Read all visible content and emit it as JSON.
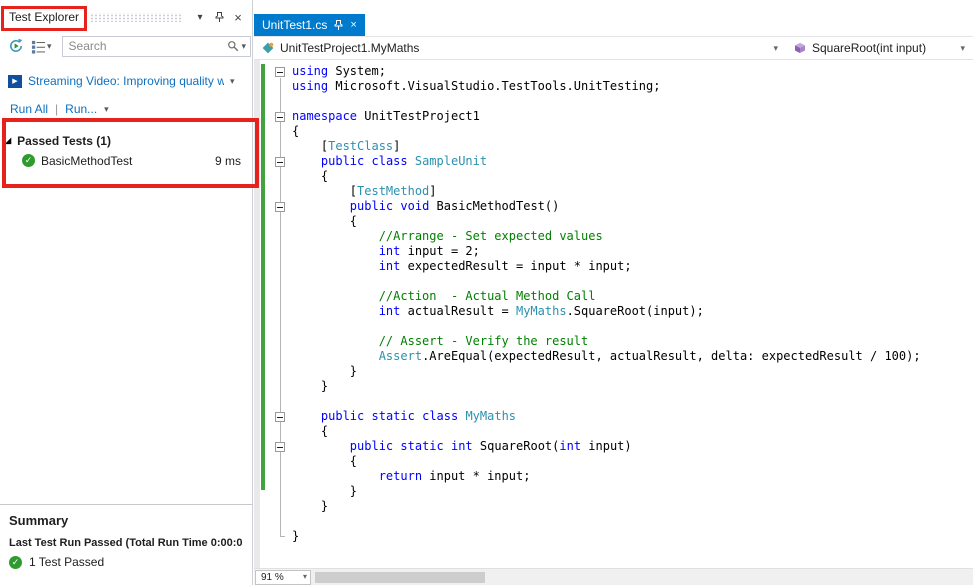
{
  "colors": {
    "accent_blue": "#007acc",
    "link_blue": "#0e70c0",
    "pass_green": "#2f9b2f",
    "change_bar_green": "#40a340",
    "annotation_red": "#e6221d",
    "keyword_blue": "#0000ff",
    "type_teal": "#2b91af",
    "comment_green": "#008000"
  },
  "icons": {
    "chevron_down": "▾",
    "close": "×",
    "check": "✓",
    "expander_expanded": "◢",
    "play": "▶"
  },
  "test_explorer": {
    "title": "Test Explorer",
    "search": {
      "placeholder": "Search"
    },
    "video_link": "Streaming Video: Improving quality wit",
    "run_all": "Run All",
    "run_menu": "Run...",
    "run_separator": "|",
    "group_header": "Passed Tests (1)",
    "tests": [
      {
        "name": "BasicMethodTest",
        "duration": "9 ms"
      }
    ],
    "summary": {
      "title": "Summary",
      "last_run": "Last Test Run Passed (Total Run Time 0:00:0",
      "passed_count": "1 Test Passed"
    }
  },
  "editor": {
    "tab_title": "UnitTest1.cs",
    "nav_left": "UnitTestProject1.MyMaths",
    "nav_right": "SquareRoot(int input)",
    "zoom": "91 %",
    "code": [
      {
        "fold": true,
        "seg": [
          [
            "k",
            "using"
          ],
          [
            "p",
            " System;"
          ]
        ]
      },
      {
        "fold": false,
        "seg": [
          [
            "k",
            "using"
          ],
          [
            "p",
            " Microsoft.VisualStudio.TestTools.UnitTesting;"
          ]
        ]
      },
      {
        "fold": false,
        "seg": []
      },
      {
        "fold": true,
        "seg": [
          [
            "k",
            "namespace"
          ],
          [
            "p",
            " UnitTestProject1"
          ]
        ]
      },
      {
        "fold": false,
        "seg": [
          [
            "p",
            "{"
          ]
        ]
      },
      {
        "fold": false,
        "seg": [
          [
            "p",
            "    ["
          ],
          [
            "t",
            "TestClass"
          ],
          [
            "p",
            "]"
          ]
        ]
      },
      {
        "fold": true,
        "seg": [
          [
            "p",
            "    "
          ],
          [
            "k",
            "public"
          ],
          [
            "p",
            " "
          ],
          [
            "k",
            "class"
          ],
          [
            "p",
            " "
          ],
          [
            "t",
            "SampleUnit"
          ]
        ]
      },
      {
        "fold": false,
        "seg": [
          [
            "p",
            "    {"
          ]
        ]
      },
      {
        "fold": false,
        "seg": [
          [
            "p",
            "        ["
          ],
          [
            "t",
            "TestMethod"
          ],
          [
            "p",
            "]"
          ]
        ]
      },
      {
        "fold": true,
        "seg": [
          [
            "p",
            "        "
          ],
          [
            "k",
            "public"
          ],
          [
            "p",
            " "
          ],
          [
            "k",
            "void"
          ],
          [
            "p",
            " BasicMethodTest()"
          ]
        ]
      },
      {
        "fold": false,
        "seg": [
          [
            "p",
            "        {"
          ]
        ]
      },
      {
        "fold": false,
        "seg": [
          [
            "p",
            "            "
          ],
          [
            "c",
            "//Arrange - Set expected values"
          ]
        ]
      },
      {
        "fold": false,
        "seg": [
          [
            "p",
            "            "
          ],
          [
            "k",
            "int"
          ],
          [
            "p",
            " input = 2;"
          ]
        ]
      },
      {
        "fold": false,
        "seg": [
          [
            "p",
            "            "
          ],
          [
            "k",
            "int"
          ],
          [
            "p",
            " expectedResult = input * input;"
          ]
        ]
      },
      {
        "fold": false,
        "seg": []
      },
      {
        "fold": false,
        "seg": [
          [
            "p",
            "            "
          ],
          [
            "c",
            "//Action  - Actual Method Call"
          ]
        ]
      },
      {
        "fold": false,
        "seg": [
          [
            "p",
            "            "
          ],
          [
            "k",
            "int"
          ],
          [
            "p",
            " actualResult = "
          ],
          [
            "t",
            "MyMaths"
          ],
          [
            "p",
            ".SquareRoot(input);"
          ]
        ]
      },
      {
        "fold": false,
        "seg": []
      },
      {
        "fold": false,
        "seg": [
          [
            "p",
            "            "
          ],
          [
            "c",
            "// Assert - Verify the result"
          ]
        ]
      },
      {
        "fold": false,
        "seg": [
          [
            "p",
            "            "
          ],
          [
            "t",
            "Assert"
          ],
          [
            "p",
            ".AreEqual(expectedResult, actualResult, delta: expectedResult / 100);"
          ]
        ]
      },
      {
        "fold": false,
        "seg": [
          [
            "p",
            "        }"
          ]
        ]
      },
      {
        "fold": false,
        "seg": [
          [
            "p",
            "    }"
          ]
        ]
      },
      {
        "fold": false,
        "seg": []
      },
      {
        "fold": true,
        "seg": [
          [
            "p",
            "    "
          ],
          [
            "k",
            "public"
          ],
          [
            "p",
            " "
          ],
          [
            "k",
            "static"
          ],
          [
            "p",
            " "
          ],
          [
            "k",
            "class"
          ],
          [
            "p",
            " "
          ],
          [
            "t",
            "MyMaths"
          ]
        ]
      },
      {
        "fold": false,
        "seg": [
          [
            "p",
            "    {"
          ]
        ]
      },
      {
        "fold": true,
        "seg": [
          [
            "p",
            "        "
          ],
          [
            "k",
            "public"
          ],
          [
            "p",
            " "
          ],
          [
            "k",
            "static"
          ],
          [
            "p",
            " "
          ],
          [
            "k",
            "int"
          ],
          [
            "p",
            " SquareRoot("
          ],
          [
            "k",
            "int"
          ],
          [
            "p",
            " input)"
          ]
        ]
      },
      {
        "fold": false,
        "seg": [
          [
            "p",
            "        {"
          ]
        ]
      },
      {
        "fold": false,
        "seg": [
          [
            "p",
            "            "
          ],
          [
            "k",
            "return"
          ],
          [
            "p",
            " input * input;"
          ]
        ]
      },
      {
        "fold": false,
        "seg": [
          [
            "p",
            "        }"
          ]
        ]
      },
      {
        "fold": false,
        "seg": [
          [
            "p",
            "    }"
          ]
        ]
      },
      {
        "fold": false,
        "seg": []
      },
      {
        "fold": false,
        "seg": [
          [
            "p",
            "}"
          ]
        ]
      }
    ]
  }
}
